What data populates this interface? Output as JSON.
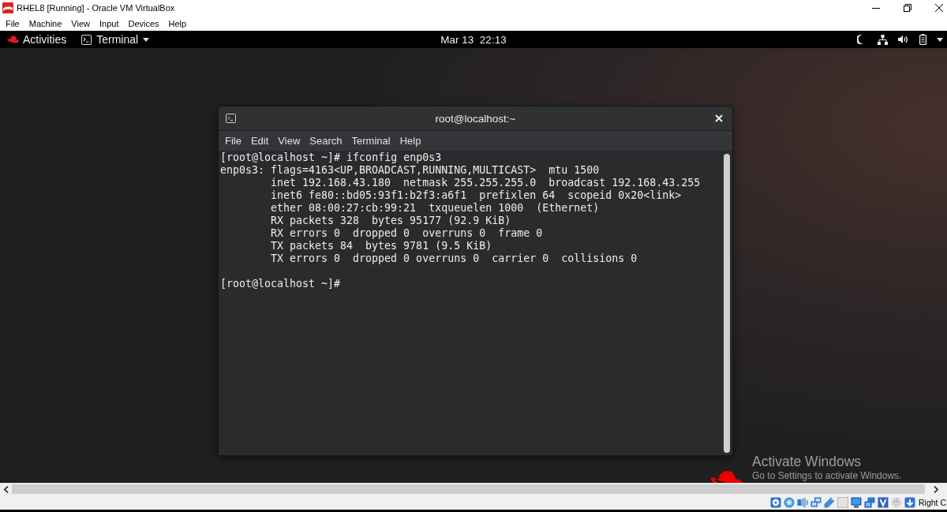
{
  "window": {
    "title": "RHEL8 [Running] - Oracle VM VirtualBox"
  },
  "menu_bar": [
    "File",
    "Machine",
    "View",
    "Input",
    "Devices",
    "Help"
  ],
  "top_bar": {
    "activities": "Activities",
    "app_menu": "Terminal",
    "clock": "Mar 13  22:13"
  },
  "terminal": {
    "title": "root@localhost:~",
    "menu": [
      "File",
      "Edit",
      "View",
      "Search",
      "Terminal",
      "Help"
    ],
    "command": "[root@localhost ~]# ifconfig enp0s3",
    "interface": "enp0s3:",
    "output": [
      "flags=4163<UP,BROADCAST,RUNNING,MULTICAST>  mtu 1500",
      "inet 192.168.43.180  netmask 255.255.255.0  broadcast 192.168.43.255",
      "inet6 fe80::bd05:93f1:b2f3:a6f1  prefixlen 64  scopeid 0x20<link>",
      "ether 08:00:27:cb:99:21  txqueuelen 1000  (Ethernet)",
      "RX packets 328  bytes 95177 (92.9 KiB)",
      "RX errors 0  dropped 0  overruns 0  frame 0",
      "TX packets 84  bytes 9781 (9.5 KiB)",
      "TX errors 0  dropped 0 overruns 0  carrier 0  collisions 0"
    ],
    "prompt": "[root@localhost ~]#"
  },
  "activation_notice": {
    "title": "Activate Windows",
    "message": "Go to Settings to activate Windows."
  },
  "status_bar": {
    "host_key": "Right C"
  }
}
